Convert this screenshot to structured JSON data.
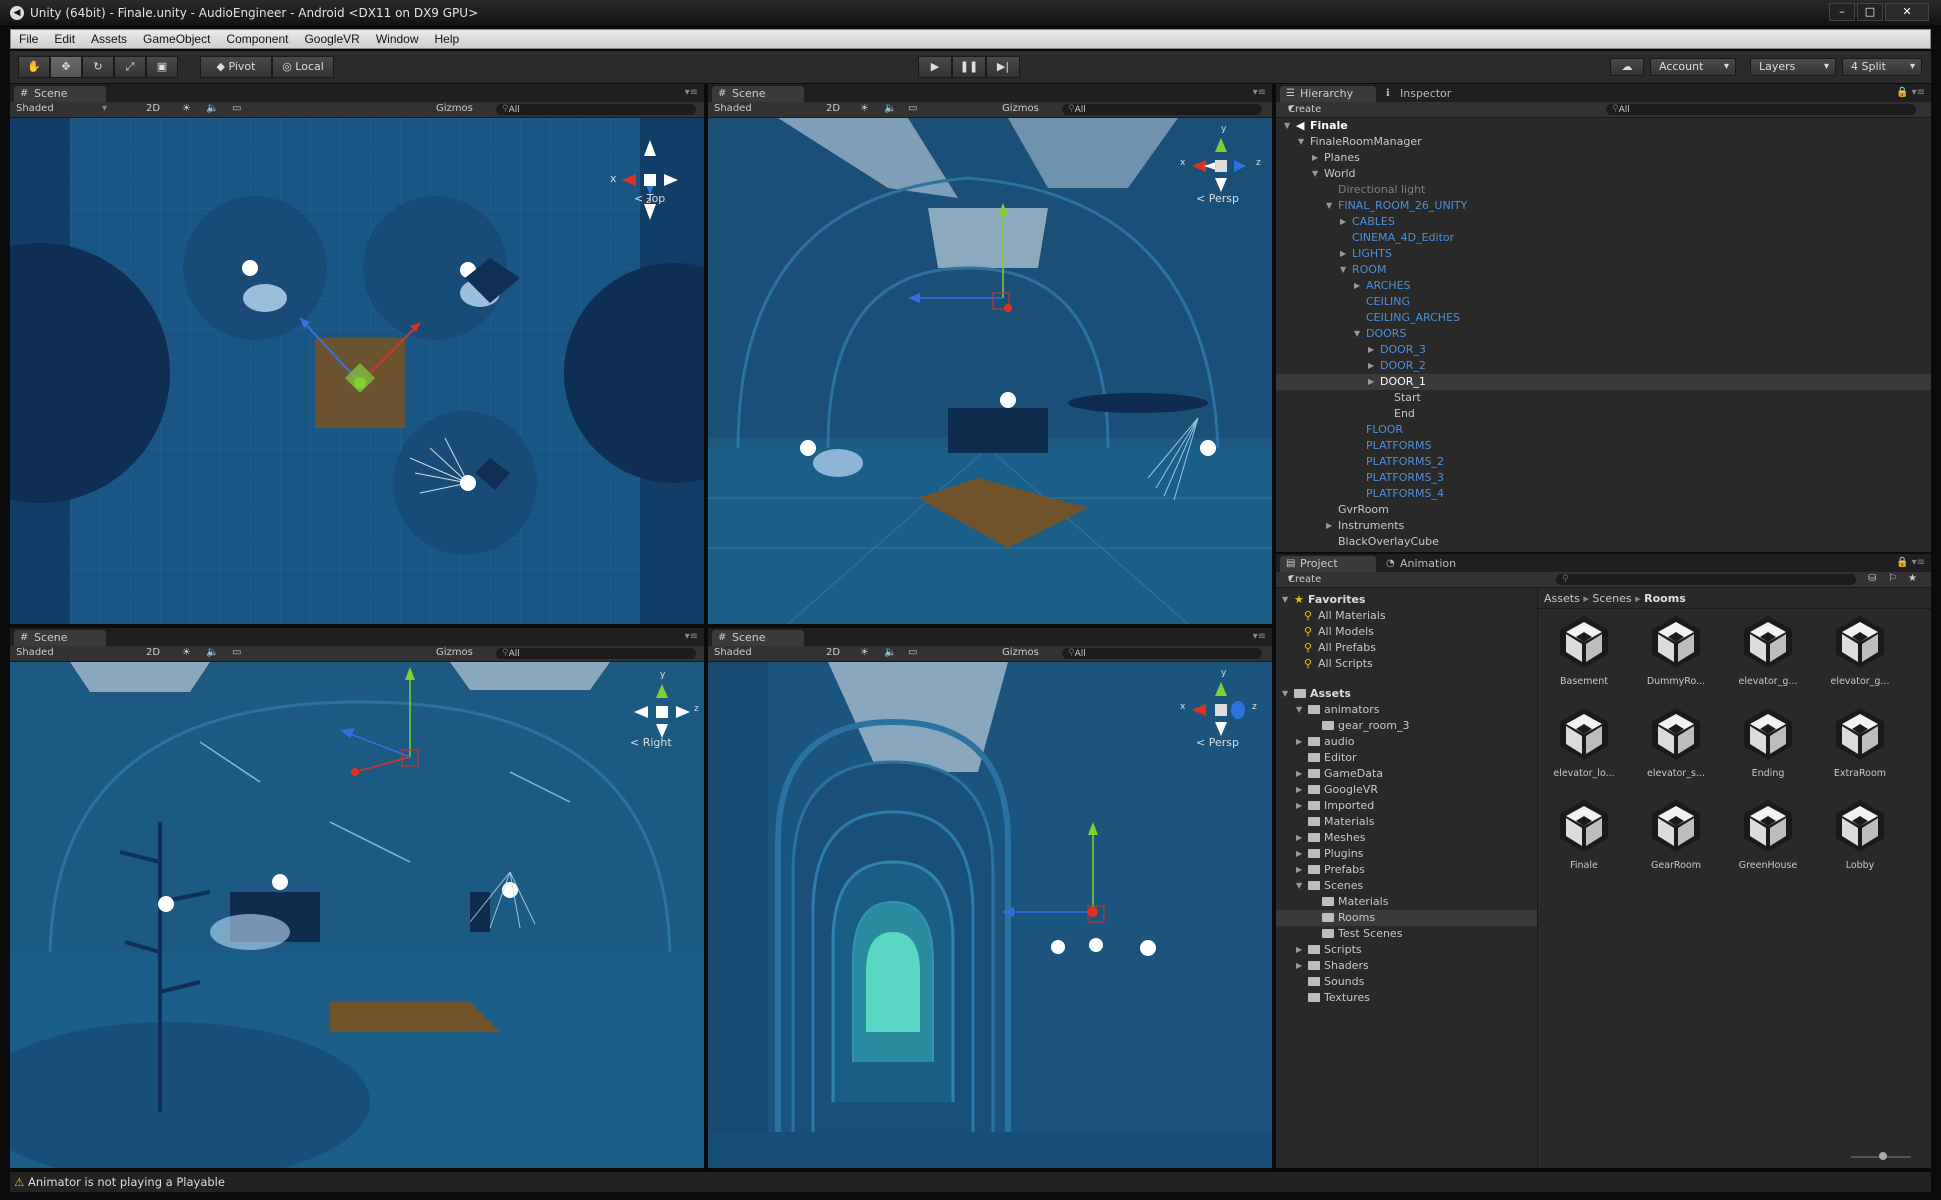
{
  "window": {
    "title": "Unity (64bit) - Finale.unity - AudioEngineer - Android <DX11 on DX9 GPU>"
  },
  "menu": [
    "File",
    "Edit",
    "Assets",
    "GameObject",
    "Component",
    "GoogleVR",
    "Window",
    "Help"
  ],
  "toolbar": {
    "pivot": "Pivot",
    "local": "Local",
    "account": "Account",
    "layers": "Layers",
    "layout": "4 Split"
  },
  "scene_views": [
    {
      "tab": "Scene",
      "shading": "Shaded",
      "mode2d": "2D",
      "gizmos": "Gizmos",
      "search": "All",
      "camera": "Top"
    },
    {
      "tab": "Scene",
      "shading": "Shaded",
      "mode2d": "2D",
      "gizmos": "Gizmos",
      "search": "All",
      "camera": "Persp"
    },
    {
      "tab": "Scene",
      "shading": "Shaded",
      "mode2d": "2D",
      "gizmos": "Gizmos",
      "search": "All",
      "camera": "Right"
    },
    {
      "tab": "Scene",
      "shading": "Shaded",
      "mode2d": "2D",
      "gizmos": "Gizmos",
      "search": "All",
      "camera": "Persp"
    }
  ],
  "gizmo_axes": {
    "x": "x",
    "y": "y",
    "z": "z"
  },
  "hierarchy": {
    "tab": "Hierarchy",
    "tab2": "Inspector",
    "create": "Create",
    "search": "All",
    "items": [
      {
        "label": "Finale",
        "depth": 0,
        "arrow": "down",
        "color": "#ffffff",
        "bold": true
      },
      {
        "label": "FinaleRoomManager",
        "depth": 1,
        "arrow": "down",
        "color": "#c8c8c8"
      },
      {
        "label": "Planes",
        "depth": 2,
        "arrow": "right",
        "color": "#c8c8c8"
      },
      {
        "label": "World",
        "depth": 2,
        "arrow": "down",
        "color": "#c8c8c8"
      },
      {
        "label": "Directional light",
        "depth": 3,
        "arrow": "",
        "color": "#7f7f7f"
      },
      {
        "label": "FINAL_ROOM_26_UNITY",
        "depth": 3,
        "arrow": "down",
        "color": "#4f8fd8"
      },
      {
        "label": "CABLES",
        "depth": 4,
        "arrow": "right",
        "color": "#4f8fd8"
      },
      {
        "label": "CINEMA_4D_Editor",
        "depth": 4,
        "arrow": "",
        "color": "#4f8fd8"
      },
      {
        "label": "LIGHTS",
        "depth": 4,
        "arrow": "right",
        "color": "#4f8fd8"
      },
      {
        "label": "ROOM",
        "depth": 4,
        "arrow": "down",
        "color": "#4f8fd8"
      },
      {
        "label": "ARCHES",
        "depth": 5,
        "arrow": "right",
        "color": "#4f8fd8"
      },
      {
        "label": "CEILING",
        "depth": 5,
        "arrow": "",
        "color": "#4f8fd8"
      },
      {
        "label": "CEILING_ARCHES",
        "depth": 5,
        "arrow": "",
        "color": "#4f8fd8"
      },
      {
        "label": "DOORS",
        "depth": 5,
        "arrow": "down",
        "color": "#4f8fd8"
      },
      {
        "label": "DOOR_3",
        "depth": 6,
        "arrow": "right",
        "color": "#4f8fd8"
      },
      {
        "label": "DOOR_2",
        "depth": 6,
        "arrow": "right",
        "color": "#4f8fd8"
      },
      {
        "label": "DOOR_1",
        "depth": 6,
        "arrow": "right",
        "color": "#ffffff",
        "selected": true
      },
      {
        "label": "Start",
        "depth": 7,
        "arrow": "",
        "color": "#c8c8c8"
      },
      {
        "label": "End",
        "depth": 7,
        "arrow": "",
        "color": "#c8c8c8"
      },
      {
        "label": "FLOOR",
        "depth": 5,
        "arrow": "",
        "color": "#4f8fd8"
      },
      {
        "label": "PLATFORMS",
        "depth": 5,
        "arrow": "",
        "color": "#4f8fd8"
      },
      {
        "label": "PLATFORMS_2",
        "depth": 5,
        "arrow": "",
        "color": "#4f8fd8"
      },
      {
        "label": "PLATFORMS_3",
        "depth": 5,
        "arrow": "",
        "color": "#4f8fd8"
      },
      {
        "label": "PLATFORMS_4",
        "depth": 5,
        "arrow": "",
        "color": "#4f8fd8"
      },
      {
        "label": "GvrRoom",
        "depth": 3,
        "arrow": "",
        "color": "#c8c8c8"
      },
      {
        "label": "Instruments",
        "depth": 3,
        "arrow": "right",
        "color": "#c8c8c8"
      },
      {
        "label": "BlackOverlayCube",
        "depth": 3,
        "arrow": "",
        "color": "#c8c8c8"
      }
    ]
  },
  "project": {
    "tab": "Project",
    "tab2": "Animation",
    "create": "Create",
    "breadcrumb": [
      "Assets",
      "Scenes",
      "Rooms"
    ],
    "favorites": {
      "label": "Favorites",
      "items": [
        "All Materials",
        "All Models",
        "All Prefabs",
        "All Scripts"
      ]
    },
    "folders": [
      {
        "label": "Assets",
        "depth": 0,
        "arrow": "down",
        "bold": true
      },
      {
        "label": "animators",
        "depth": 1,
        "arrow": "down"
      },
      {
        "label": "gear_room_3",
        "depth": 2,
        "arrow": ""
      },
      {
        "label": "audio",
        "depth": 1,
        "arrow": "right"
      },
      {
        "label": "Editor",
        "depth": 1,
        "arrow": ""
      },
      {
        "label": "GameData",
        "depth": 1,
        "arrow": "right"
      },
      {
        "label": "GoogleVR",
        "depth": 1,
        "arrow": "right"
      },
      {
        "label": "Imported",
        "depth": 1,
        "arrow": "right"
      },
      {
        "label": "Materials",
        "depth": 1,
        "arrow": ""
      },
      {
        "label": "Meshes",
        "depth": 1,
        "arrow": "right"
      },
      {
        "label": "Plugins",
        "depth": 1,
        "arrow": "right"
      },
      {
        "label": "Prefabs",
        "depth": 1,
        "arrow": "right"
      },
      {
        "label": "Scenes",
        "depth": 1,
        "arrow": "down"
      },
      {
        "label": "Materials",
        "depth": 2,
        "arrow": ""
      },
      {
        "label": "Rooms",
        "depth": 2,
        "arrow": "",
        "selected": true
      },
      {
        "label": "Test Scenes",
        "depth": 2,
        "arrow": ""
      },
      {
        "label": "Scripts",
        "depth": 1,
        "arrow": "right"
      },
      {
        "label": "Shaders",
        "depth": 1,
        "arrow": "right"
      },
      {
        "label": "Sounds",
        "depth": 1,
        "arrow": ""
      },
      {
        "label": "Textures",
        "depth": 1,
        "arrow": ""
      }
    ],
    "assets": [
      "Basement",
      "DummyRo...",
      "elevator_g...",
      "elevator_g...",
      "elevator_lo...",
      "elevator_s...",
      "Ending",
      "ExtraRoom",
      "Finale",
      "GearRoom",
      "GreenHouse",
      "Lobby"
    ]
  },
  "status": {
    "message": "Animator is not playing a Playable"
  },
  "colors": {
    "scene_bg": "#1c5a84",
    "scene_dark": "#0f3558",
    "accent_blue": "#4f8fd8",
    "axis_x": "#e03020",
    "axis_y": "#80d030",
    "axis_z": "#3070e0",
    "warning": "#f0c000"
  }
}
